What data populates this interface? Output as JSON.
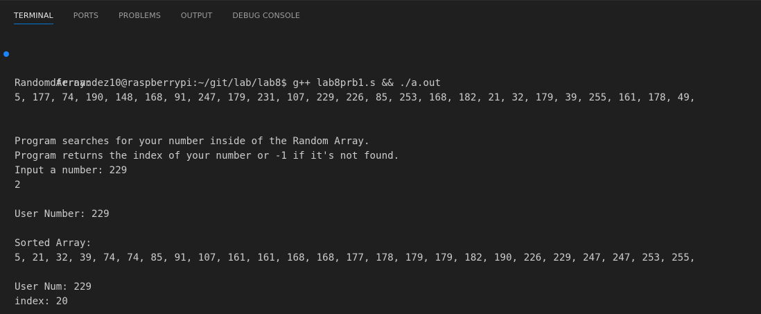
{
  "tabs": [
    {
      "label": "TERMINAL",
      "active": true
    },
    {
      "label": "PORTS",
      "active": false
    },
    {
      "label": "PROBLEMS",
      "active": false
    },
    {
      "label": "OUTPUT",
      "active": false
    },
    {
      "label": "DEBUG CONSOLE",
      "active": false
    }
  ],
  "colors": {
    "accent": "#0078d4",
    "command_decoration": "#1a85ff",
    "background": "#1f1f1f",
    "text": "#cccccc"
  },
  "terminal": {
    "command": "dfernandez10@raspberrypi:~/git/lab/lab8$ g++ lab8prb1.s && ./a.out",
    "lines": [
      "",
      "Random Array:",
      "5, 177, 74, 190, 148, 168, 91, 247, 179, 231, 107, 229, 226, 85, 253, 168, 182, 21, 32, 179, 39, 255, 161, 178, 49,",
      "",
      "",
      "Program searches for your number inside of the Random Array.",
      "Program returns the index of your number or -1 if it's not found.",
      "Input a number: 229",
      "2",
      "",
      "User Number: 229",
      "",
      "Sorted Array:",
      "5, 21, 32, 39, 74, 74, 85, 91, 107, 161, 161, 168, 168, 177, 178, 179, 179, 182, 190, 226, 229, 247, 247, 253, 255,",
      "",
      "User Num: 229",
      "index: 20"
    ]
  }
}
